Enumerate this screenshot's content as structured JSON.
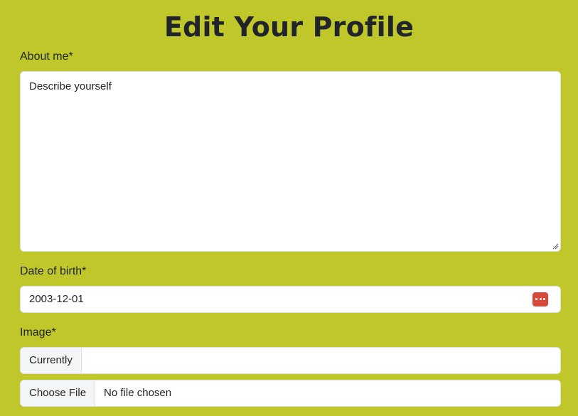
{
  "page": {
    "title": "Edit Your Profile"
  },
  "about": {
    "label": "About me*",
    "placeholder": "Describe yourself"
  },
  "dob": {
    "label": "Date of birth*",
    "value": "2003-12-01",
    "icon": "calendar-icon",
    "icon_color": "#d9473b"
  },
  "image": {
    "label": "Image*",
    "currently_label": "Currently",
    "currently_value": "",
    "choose_file_label": "Choose File",
    "file_status": "No file chosen"
  },
  "theme": {
    "background": "#bfc72a"
  }
}
